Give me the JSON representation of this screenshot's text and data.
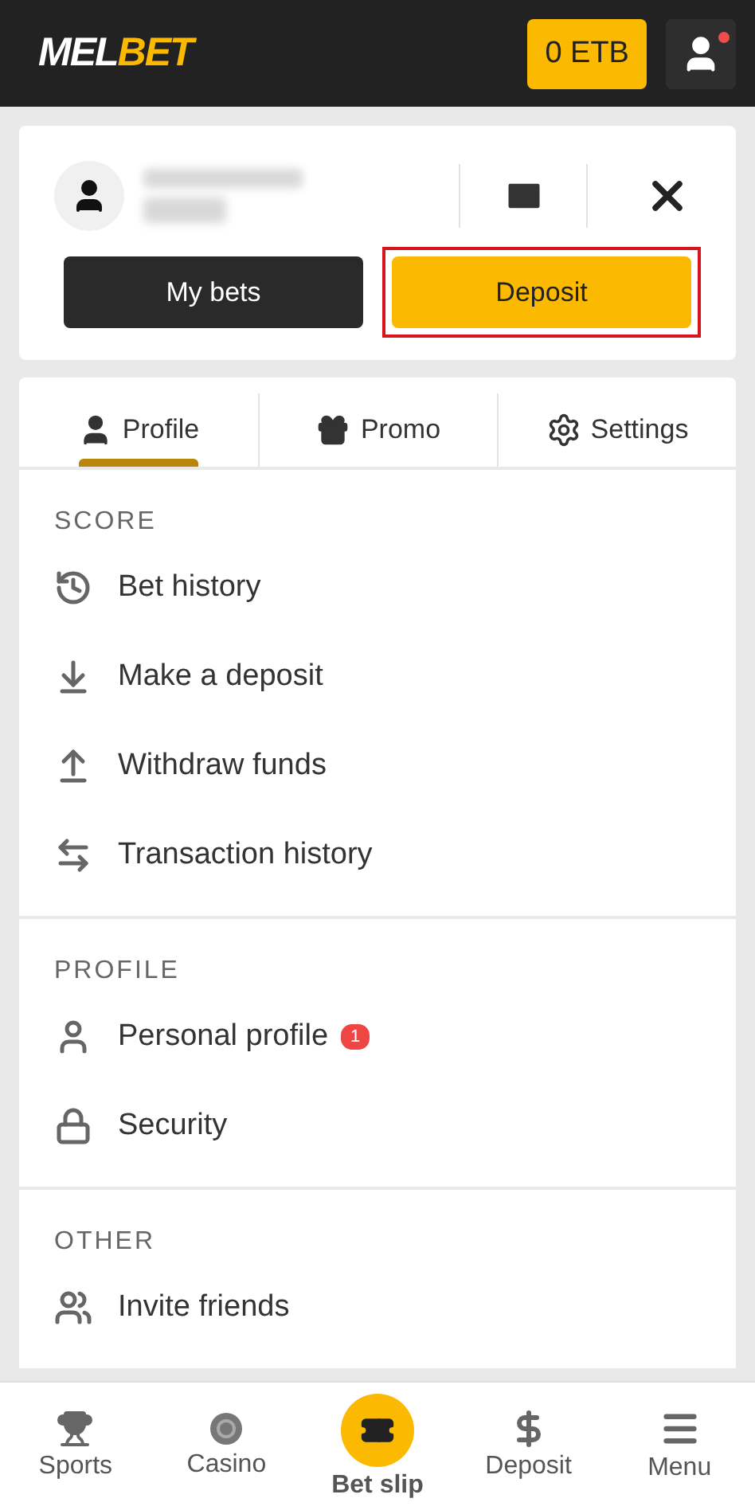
{
  "header": {
    "logo": [
      {
        "text": "MEL",
        "color": "#ffffff"
      },
      {
        "text": "BET",
        "color": "#fbb901"
      }
    ],
    "balance": "0 ETB",
    "notification": true
  },
  "account": {
    "buttons": [
      {
        "label": "My bets",
        "kind": "dark"
      },
      {
        "label": "Deposit",
        "kind": "primary",
        "highlighted": true
      }
    ]
  },
  "tabs": [
    {
      "label": "Profile",
      "selected": true
    },
    {
      "label": "Promo",
      "selected": false
    },
    {
      "label": "Settings",
      "selected": false
    }
  ],
  "sections": [
    {
      "title": "SCORE",
      "items": [
        {
          "label": "Bet history"
        },
        {
          "label": "Make a deposit"
        },
        {
          "label": "Withdraw funds"
        },
        {
          "label": "Transaction history"
        }
      ]
    },
    {
      "title": "PROFILE",
      "items": [
        {
          "label": "Personal profile",
          "badge": "1"
        },
        {
          "label": "Security"
        }
      ]
    },
    {
      "title": "OTHER",
      "items": [
        {
          "label": "Invite friends"
        }
      ]
    }
  ],
  "bottom_nav": [
    {
      "label": "Sports",
      "kind": "plain"
    },
    {
      "label": "Casino",
      "kind": "plain"
    },
    {
      "label": "Bet slip",
      "kind": "center"
    },
    {
      "label": "Deposit",
      "kind": "plain"
    },
    {
      "label": "Menu",
      "kind": "plain"
    }
  ]
}
